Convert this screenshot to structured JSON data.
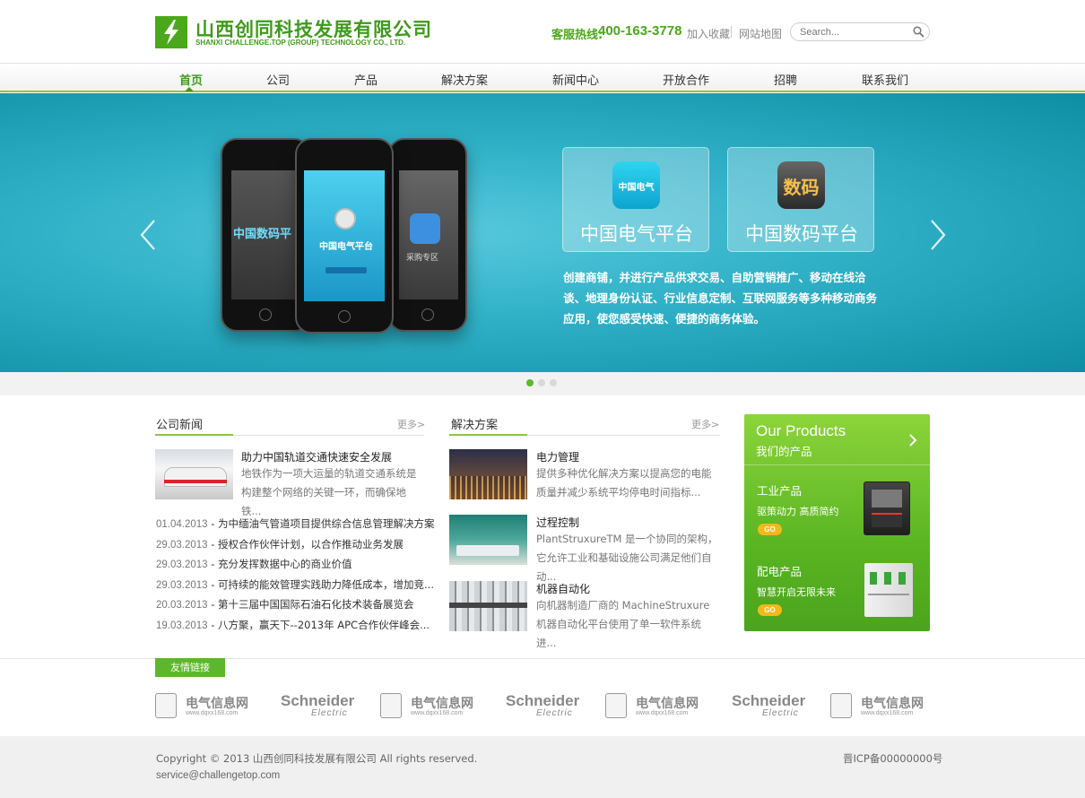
{
  "header": {
    "company_cn": "山西创同科技发展有限公司",
    "company_en": "SHANXI CHALLENGE.TOP (GROUP) TECHNOLOGY CO., LTD.",
    "hotline_label": "客服热线:",
    "hotline_number": "400-163-3778",
    "bookmark": "加入收藏",
    "sitemap": "网站地图",
    "search_placeholder": "Search..."
  },
  "nav": [
    "首页",
    "公司",
    "产品",
    "解决方案",
    "新闻中心",
    "开放合作",
    "招聘",
    "联系我们"
  ],
  "banner": {
    "tiles": [
      "中国电气平台",
      "中国数码平台"
    ],
    "icon_labels": [
      "中国电气",
      "数码"
    ],
    "description": "创建商铺，并进行产品供求交易、自助营销推广、移动在线洽谈、地理身份认证、行业信息定制、互联网服务等多种移动商务应用，使您感受快速、便捷的商务体验。",
    "phone_texts": [
      "中国数码平",
      "中国电气平台",
      "采购专区"
    ],
    "slide_total": 3,
    "slide_active": 1
  },
  "news": {
    "title": "公司新闻",
    "more": "更多>",
    "featured_title": "助力中国轨道交通快速安全发展",
    "featured_desc": "地铁作为一项大运量的轨道交通系统是构建整个网络的关键一环，而确保地铁...",
    "items": [
      {
        "date": "01.04.2013",
        "text": " - 为中缅油气管道项目提供综合信息管理解决方案"
      },
      {
        "date": "29.03.2013",
        "text": " - 授权合作伙伴计划，以合作推动业务发展"
      },
      {
        "date": "29.03.2013",
        "text": " - 充分发挥数据中心的商业价值"
      },
      {
        "date": "29.03.2013",
        "text": " - 可持续的能效管理实践助力降低成本，增加竞..."
      },
      {
        "date": "20.03.2013",
        "text": " - 第十三届中国国际石油石化技术装备展览会"
      },
      {
        "date": "19.03.2013",
        "text": " - 八方聚，赢天下--2013年 APC合作伙伴峰会..."
      }
    ]
  },
  "solutions": {
    "title": "解决方案",
    "more": "更多>",
    "items": [
      {
        "title": "电力管理",
        "desc": "提供多种优化解决方案以提高您的电能质量并减少系统平均停电时间指标..."
      },
      {
        "title": "过程控制",
        "desc": "PlantStruxureTM 是一个协同的架构，它允许工业和基础设施公司满足他们自动..."
      },
      {
        "title": "机器自动化",
        "desc": "向机器制造厂商的 MachineStruxure 机器自动化平台使用了单一软件系统进..."
      }
    ]
  },
  "products": {
    "title_en": "Our Products",
    "title_cn": "我们的产品",
    "items": [
      {
        "name": "工业产品",
        "slogan": "驱策动力 高质简约",
        "go": "GO"
      },
      {
        "name": "配电产品",
        "slogan": "智慧开启无限未来",
        "go": "GO"
      }
    ]
  },
  "links": {
    "title": "友情链接",
    "partners": [
      {
        "name": "电气信息网",
        "url": "www.dqxx168.com"
      },
      {
        "name": "Schneider",
        "sub": "Electric"
      },
      {
        "name": "电气信息网",
        "url": "www.dqxx168.com"
      },
      {
        "name": "Schneider",
        "sub": "Electric"
      },
      {
        "name": "电气信息网",
        "url": "www.dqxx168.com"
      },
      {
        "name": "Schneider",
        "sub": "Electric"
      },
      {
        "name": "电气信息网",
        "url": "www.dqxx168.com"
      }
    ]
  },
  "footer": {
    "copyright": "Copyright © 2013 山西创同科技发展有限公司 All rights reserved.",
    "email": "service@challengetop.com",
    "icp": "晋ICP备00000000号"
  },
  "colors": {
    "brand_green": "#4aa81a",
    "banner_teal": "#2fb0c7",
    "go_orange": "#f6b81a"
  }
}
